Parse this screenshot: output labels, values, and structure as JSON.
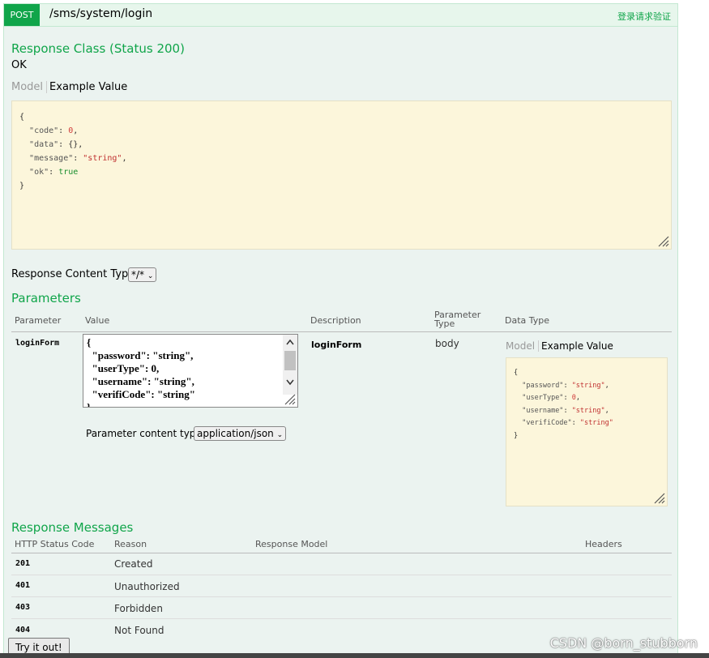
{
  "operation": {
    "method": "POST",
    "path": "/sms/system/login",
    "summary": "登录请求验证"
  },
  "response_class": {
    "title": "Response Class (Status 200)",
    "status_text": "OK",
    "tab_model": "Model",
    "tab_example": "Example Value",
    "example": {
      "open": "{",
      "code_key": "\"code\"",
      "code_val": "0",
      "data_key": "\"data\"",
      "data_val": "{}",
      "message_key": "\"message\"",
      "message_val": "\"string\"",
      "ok_key": "\"ok\"",
      "ok_val": "true",
      "close": "}"
    }
  },
  "response_content_type": {
    "label": "Response Content Type",
    "value": "*/*"
  },
  "parameters": {
    "title": "Parameters",
    "headers": {
      "parameter": "Parameter",
      "value": "Value",
      "description": "Description",
      "parameter_type_line1": "Parameter",
      "parameter_type_line2": "Type",
      "data_type": "Data Type"
    },
    "row": {
      "name": "loginForm",
      "textarea_lines": [
        "{",
        "  \"password\": \"string\",",
        "  \"userType\": 0,",
        "  \"username\": \"string\",",
        "  \"verifiCode\": \"string\"",
        "}"
      ],
      "description": "loginForm",
      "type": "body",
      "content_type_label": "Parameter content type:",
      "content_type_value": "application/json",
      "tab_model": "Model",
      "tab_example": "Example Value",
      "example": {
        "open": "{",
        "password_key": "\"password\"",
        "password_val": "\"string\"",
        "usertype_key": "\"userType\"",
        "usertype_val": "0",
        "username_key": "\"username\"",
        "username_val": "\"string\"",
        "verificode_key": "\"verifiCode\"",
        "verificode_val": "\"string\"",
        "close": "}"
      }
    }
  },
  "response_messages": {
    "title": "Response Messages",
    "headers": {
      "code": "HTTP Status Code",
      "reason": "Reason",
      "model": "Response Model",
      "headers": "Headers"
    },
    "rows": [
      {
        "code": "201",
        "reason": "Created"
      },
      {
        "code": "401",
        "reason": "Unauthorized"
      },
      {
        "code": "403",
        "reason": "Forbidden"
      },
      {
        "code": "404",
        "reason": "Not Found"
      }
    ]
  },
  "try_button": "Try it out!",
  "watermark": "CSDN @born_stubborn",
  "colors": {
    "accent_green": "#10a54a",
    "panel_bg": "#ebf3f0",
    "code_bg": "#fcf6db"
  }
}
